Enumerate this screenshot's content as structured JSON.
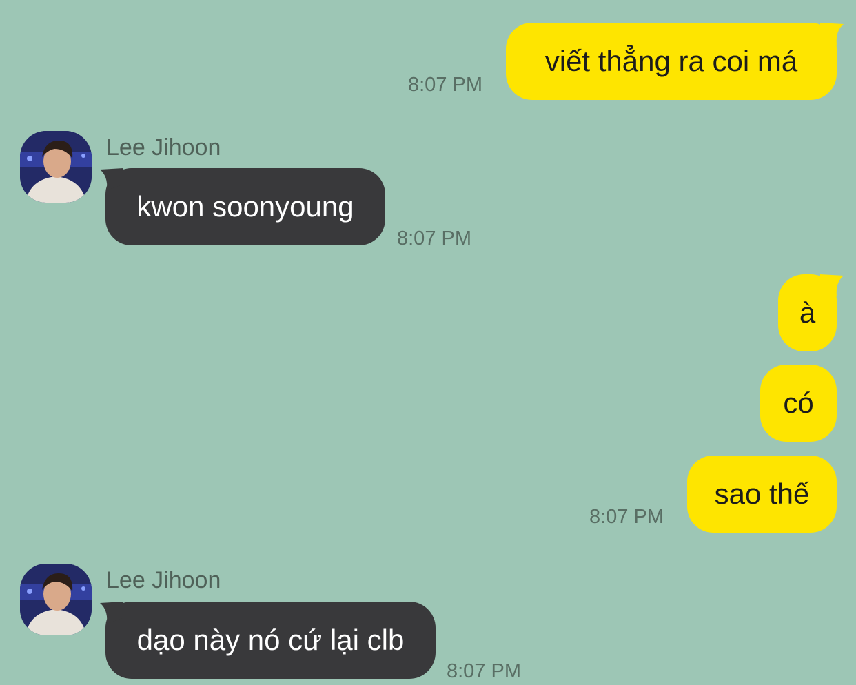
{
  "messages": [
    {
      "sender": "me",
      "text": "viết thẳng ra coi má",
      "time": "8:07 PM"
    },
    {
      "sender": "Lee Jihoon",
      "text": "kwon soonyoung",
      "time": "8:07 PM"
    },
    {
      "sender": "me",
      "text": "à"
    },
    {
      "sender": "me",
      "text": "có"
    },
    {
      "sender": "me",
      "text": "sao thế",
      "time": "8:07 PM"
    },
    {
      "sender": "Lee Jihoon",
      "text": "dạo này nó cứ lại clb",
      "time": "8:07 PM"
    }
  ],
  "contact": {
    "name": "Lee Jihoon",
    "avatar_icon": "profile-photo-icon"
  },
  "colors": {
    "background": "#9dc6b5",
    "outgoing_bubble": "#fee500",
    "incoming_bubble": "#39393b",
    "timestamp": "#596e64"
  }
}
